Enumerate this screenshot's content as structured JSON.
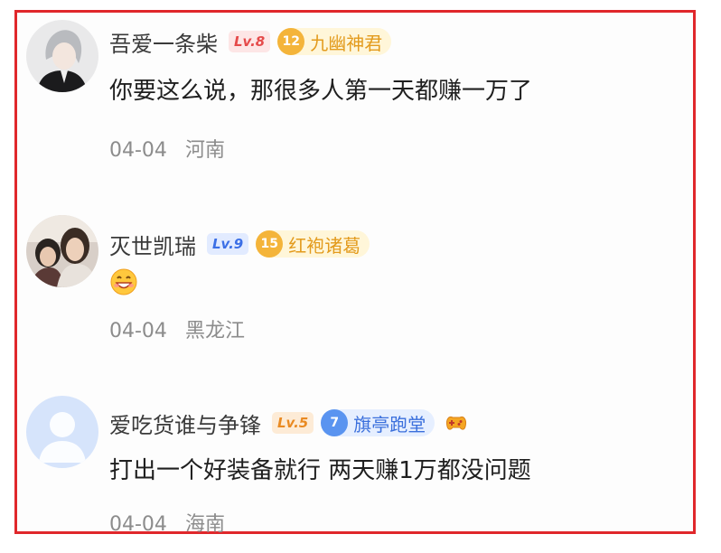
{
  "comments": [
    {
      "username": "吾爱一条柴",
      "level": "Lv.8",
      "fan_level": "12",
      "fan_title": "九幽神君",
      "text": "你要这么说，那很多人第一天都赚一万了",
      "date": "04-04",
      "location": "河南",
      "avatar_icon": "gray-haired-cartoon-avatar"
    },
    {
      "username": "灭世凯瑞",
      "level": "Lv.9",
      "fan_level": "15",
      "fan_title": "红袍诸葛",
      "text_emoji": "grinning-face-emoji",
      "date": "04-04",
      "location": "黑龙江",
      "avatar_icon": "photo-avatar"
    },
    {
      "username": "爱吃货谁与争锋",
      "level": "Lv.5",
      "fan_level": "7",
      "fan_title": "旗亭跑堂",
      "extra_icon": "gamepad-icon",
      "text": "打出一个好装备就行 两天赚1万都没问题",
      "date": "04-04",
      "location": "海南",
      "avatar_icon": "default-user-avatar"
    }
  ]
}
